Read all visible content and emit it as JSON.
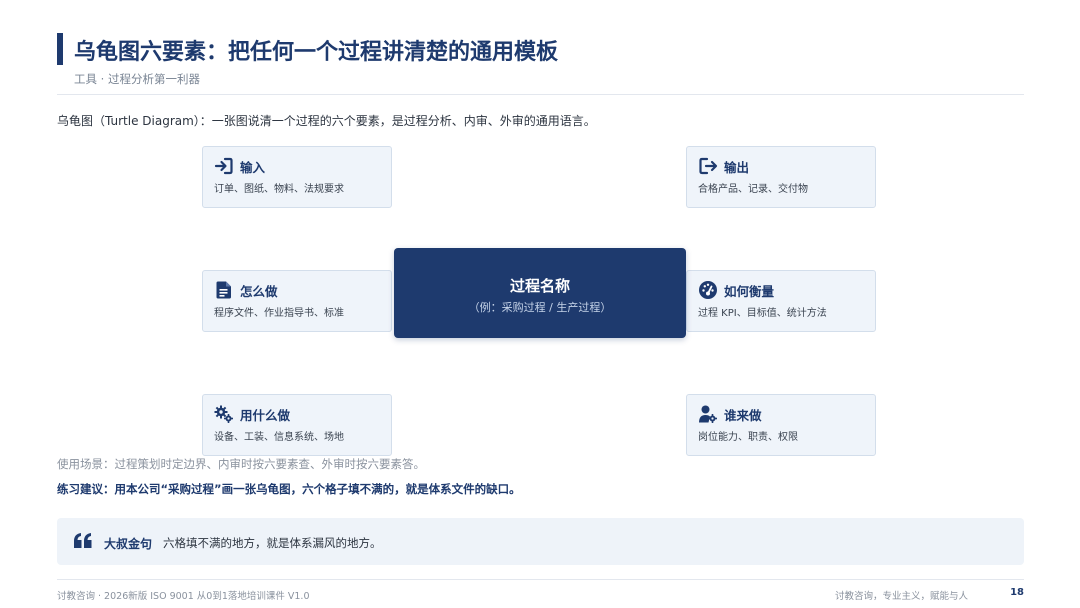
{
  "header": {
    "title": "乌龟图六要素：把任何一个过程讲清楚的通用模板",
    "subtitle": "工具 · 过程分析第一利器"
  },
  "intro": "乌龟图（Turtle Diagram）：一张图说清一个过程的六个要素，是过程分析、内审、外审的通用语言。",
  "diagram": {
    "center": {
      "name": "过程名称",
      "example": "（例：采购过程 / 生产过程）"
    },
    "input": {
      "label": "输入",
      "desc": "订单、图纸、物料、法规要求",
      "icon": "login-arrow-icon"
    },
    "output": {
      "label": "输出",
      "desc": "合格产品、记录、交付物",
      "icon": "logout-arrow-icon"
    },
    "how": {
      "label": "怎么做",
      "desc": "程序文件、作业指导书、标准",
      "icon": "document-icon"
    },
    "measure": {
      "label": "如何衡量",
      "desc": "过程 KPI、目标值、统计方法",
      "icon": "gauge-icon"
    },
    "with_what": {
      "label": "用什么做",
      "desc": "设备、工装、信息系统、场地",
      "icon": "gears-icon"
    },
    "who": {
      "label": "谁来做",
      "desc": "岗位能力、职责、权限",
      "icon": "user-gear-icon"
    }
  },
  "usage": "使用场景：过程策划时定边界、内审时按六要素查、外审时按六要素答。",
  "advice": "练习建议：用本公司“采购过程”画一张乌龟图，六个格子填不满的，就是体系文件的缺口。",
  "quote": {
    "label": "大叔金句",
    "text": "六格填不满的地方，就是体系漏风的地方。"
  },
  "footer": {
    "left": "讨教咨询 · 2026新版 ISO 9001 从0到1落地培训课件 V1.0",
    "right": "讨教咨询，专业主义，赋能与人",
    "page": "18"
  },
  "colors": {
    "primary": "#1e3a6e",
    "card_bg": "#eff4fa",
    "card_border": "#d3deeb"
  }
}
